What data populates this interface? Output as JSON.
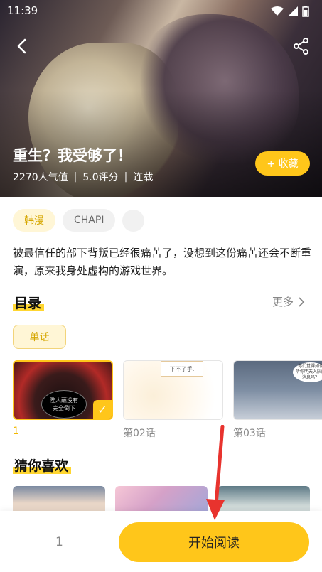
{
  "status_bar": {
    "time": "11:39"
  },
  "comic": {
    "title": "重生？我受够了！",
    "popularity": "2270人气值",
    "rating": "5.0评分",
    "status": "连载",
    "favorite_label": "+ 收藏"
  },
  "tags": [
    "韩漫",
    "CHAPI"
  ],
  "description": "被最信任的部下背叛已经很痛苦了，没想到这份痛苦还会不断重演，原来我身处虚构的游戏世界。",
  "catalog": {
    "title": "目录",
    "more_label": "更多",
    "filter_label": "单话",
    "chapters": [
      {
        "label": "1",
        "thumb_text": "陛人蘸没有\n完全倒下"
      },
      {
        "label": "第02话",
        "thumb_text": "下不了手."
      },
      {
        "label": "第03话",
        "thumb_text": "你们觉得如何\n听你明天入队的\n消息吗？"
      }
    ]
  },
  "recommend": {
    "title": "猜你喜欢"
  },
  "bottom_bar": {
    "chapter_number": "1",
    "start_label": "开始阅读"
  },
  "colors": {
    "accent": "#ffc61a",
    "annotation_arrow": "#e8332e"
  }
}
